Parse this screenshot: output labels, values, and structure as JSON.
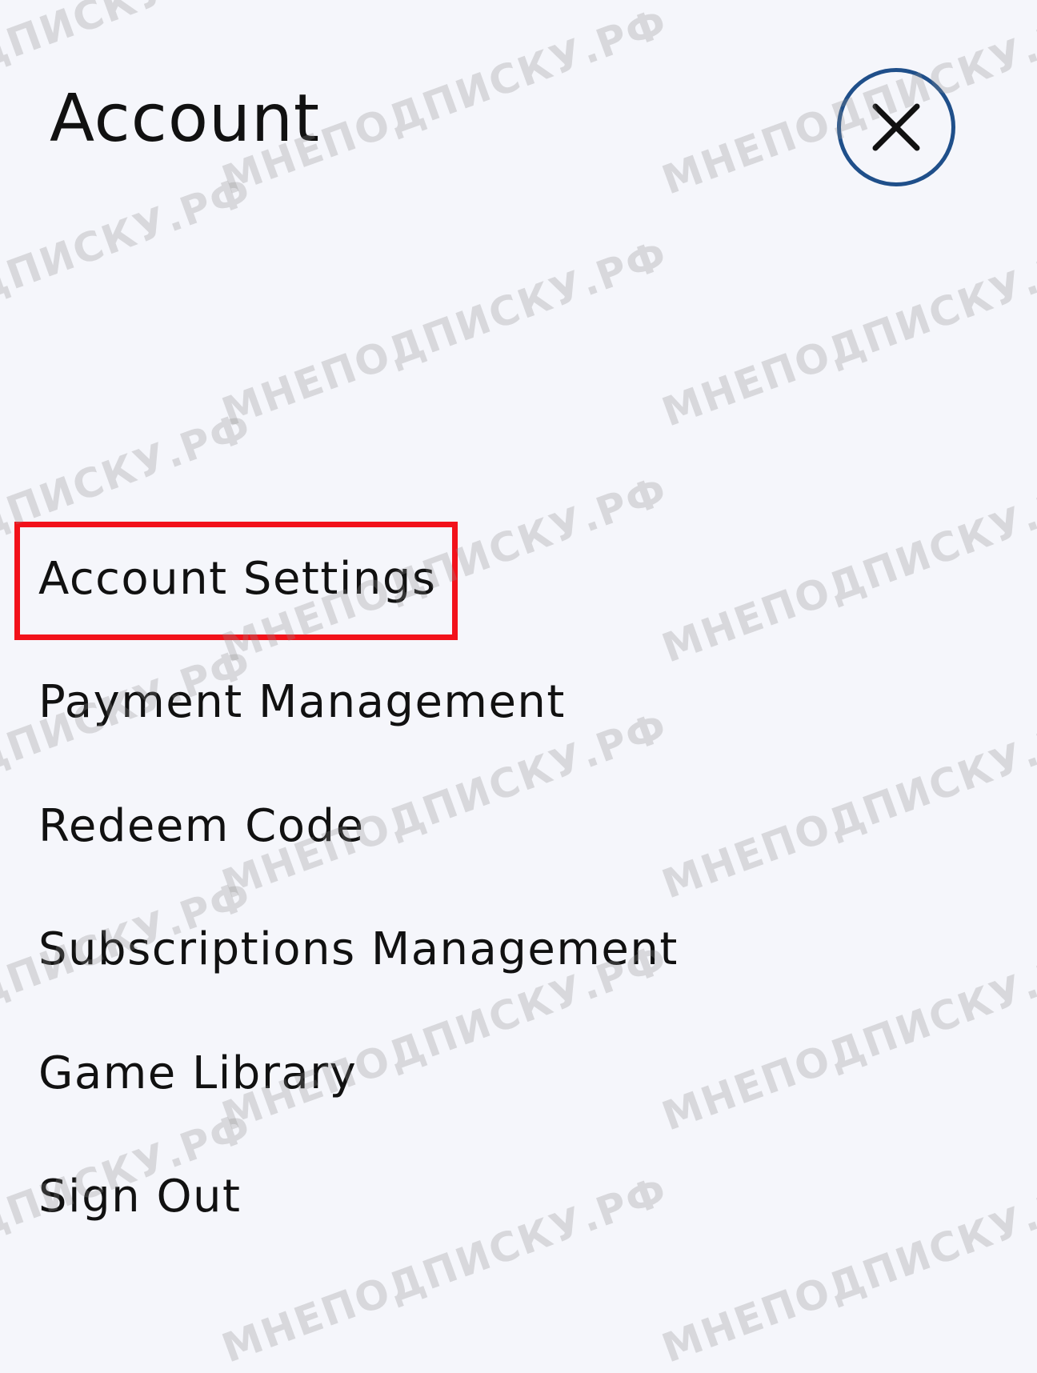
{
  "header": {
    "title": "Account"
  },
  "menu": {
    "items": [
      {
        "label": "Account Settings"
      },
      {
        "label": "Payment Management"
      },
      {
        "label": "Redeem Code"
      },
      {
        "label": "Subscriptions Management"
      },
      {
        "label": "Game Library"
      },
      {
        "label": "Sign Out"
      }
    ]
  },
  "watermark": {
    "text": "МНЕПОДПИСКУ.РФ"
  },
  "colors": {
    "background": "#f5f6fb",
    "close_ring": "#1f4f8a",
    "highlight": "#f2121a"
  }
}
